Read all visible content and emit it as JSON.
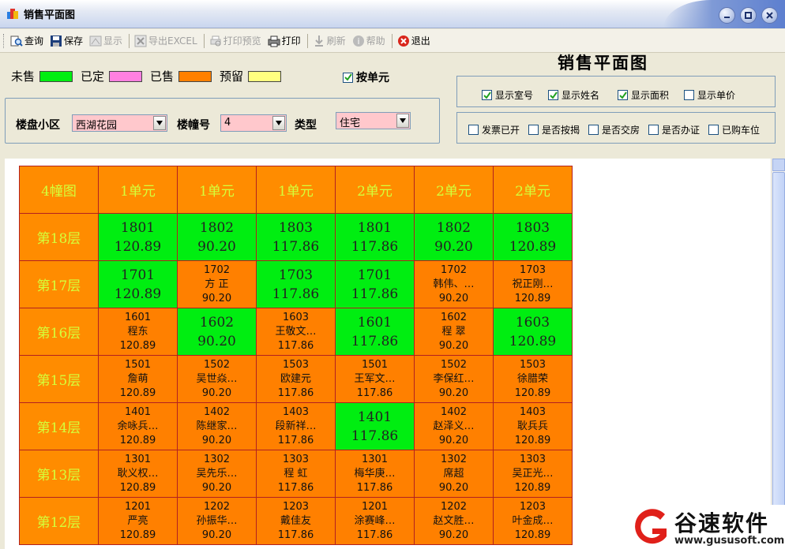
{
  "window": {
    "title": "销售平面图"
  },
  "toolbar": {
    "items": [
      {
        "label": "查询",
        "icon": "search-icon",
        "enabled": true
      },
      {
        "label": "保存",
        "icon": "save-icon",
        "enabled": true
      },
      {
        "label": "显示",
        "icon": "display-icon",
        "enabled": false
      },
      {
        "label": "导出EXCEL",
        "icon": "excel-icon",
        "enabled": false
      },
      {
        "label": "打印预览",
        "icon": "print-preview-icon",
        "enabled": false
      },
      {
        "label": "打印",
        "icon": "print-icon",
        "enabled": true
      },
      {
        "label": "刷新",
        "icon": "refresh-icon",
        "enabled": false
      },
      {
        "label": "帮助",
        "icon": "help-icon",
        "enabled": false
      },
      {
        "label": "退出",
        "icon": "exit-icon",
        "enabled": true
      }
    ]
  },
  "legend": {
    "items": [
      {
        "label": "未售",
        "color": "#00ee11"
      },
      {
        "label": "已定",
        "color": "#ff80e0"
      },
      {
        "label": "已售",
        "color": "#ff8000"
      },
      {
        "label": "预留",
        "color": "#ffff80"
      }
    ],
    "by_unit": {
      "label": "按单元",
      "checked": true
    }
  },
  "filter": {
    "estate_label": "楼盘小区",
    "estate_value": "西湖花园",
    "building_label": "楼幢号",
    "building_value": "4",
    "type_label": "类型",
    "type_value": "住宅"
  },
  "panel_title": "销售平面图",
  "display_options": [
    {
      "label": "显示室号",
      "checked": true
    },
    {
      "label": "显示姓名",
      "checked": true
    },
    {
      "label": "显示面积",
      "checked": true
    },
    {
      "label": "显示单价",
      "checked": false
    }
  ],
  "status_options": [
    {
      "label": "发票已开",
      "checked": false
    },
    {
      "label": "是否按揭",
      "checked": false
    },
    {
      "label": "是否交房",
      "checked": false
    },
    {
      "label": "是否办证",
      "checked": false
    },
    {
      "label": "已购车位",
      "checked": false
    }
  ],
  "grid": {
    "corner": "4幢图",
    "columns": [
      "1单元",
      "1单元",
      "1单元",
      "2单元",
      "2单元",
      "2单元"
    ],
    "rows": [
      {
        "floor": "第18层",
        "cells": [
          {
            "status": "unsold",
            "no": "1801",
            "area": "120.89"
          },
          {
            "status": "unsold",
            "no": "1802",
            "area": "90.20"
          },
          {
            "status": "unsold",
            "no": "1803",
            "area": "117.86"
          },
          {
            "status": "unsold",
            "no": "1801",
            "area": "117.86"
          },
          {
            "status": "unsold",
            "no": "1802",
            "area": "90.20"
          },
          {
            "status": "unsold",
            "no": "1803",
            "area": "120.89"
          }
        ]
      },
      {
        "floor": "第17层",
        "cells": [
          {
            "status": "unsold",
            "no": "1701",
            "area": "120.89"
          },
          {
            "status": "sold",
            "no": "1702",
            "name": "方 正",
            "area": "90.20"
          },
          {
            "status": "unsold",
            "no": "1703",
            "area": "117.86"
          },
          {
            "status": "unsold",
            "no": "1701",
            "area": "117.86"
          },
          {
            "status": "sold",
            "no": "1702",
            "name": "韩伟、…",
            "area": "90.20"
          },
          {
            "status": "sold",
            "no": "1703",
            "name": "祝正刚…",
            "area": "120.89"
          }
        ]
      },
      {
        "floor": "第16层",
        "cells": [
          {
            "status": "sold",
            "no": "1601",
            "name": "程东",
            "area": "120.89"
          },
          {
            "status": "unsold",
            "no": "1602",
            "area": "90.20"
          },
          {
            "status": "sold",
            "no": "1603",
            "name": "王敬文…",
            "area": "117.86"
          },
          {
            "status": "unsold",
            "no": "1601",
            "area": "117.86"
          },
          {
            "status": "sold",
            "no": "1602",
            "name": "程 翠",
            "area": "90.20"
          },
          {
            "status": "unsold",
            "no": "1603",
            "area": "120.89"
          }
        ]
      },
      {
        "floor": "第15层",
        "cells": [
          {
            "status": "sold",
            "no": "1501",
            "name": "詹萌",
            "area": "120.89"
          },
          {
            "status": "sold",
            "no": "1502",
            "name": "吴世焱…",
            "area": "90.20"
          },
          {
            "status": "sold",
            "no": "1503",
            "name": "欧建元",
            "area": "117.86"
          },
          {
            "status": "sold",
            "no": "1501",
            "name": "王军文…",
            "area": "117.86"
          },
          {
            "status": "sold",
            "no": "1502",
            "name": "李保红…",
            "area": "90.20"
          },
          {
            "status": "sold",
            "no": "1503",
            "name": "徐腊荣",
            "area": "120.89"
          }
        ]
      },
      {
        "floor": "第14层",
        "cells": [
          {
            "status": "sold",
            "no": "1401",
            "name": "余咏兵…",
            "area": "120.89"
          },
          {
            "status": "sold",
            "no": "1402",
            "name": "陈继家…",
            "area": "90.20"
          },
          {
            "status": "sold",
            "no": "1403",
            "name": "段新祥…",
            "area": "117.86"
          },
          {
            "status": "unsold",
            "no": "1401",
            "area": "117.86"
          },
          {
            "status": "sold",
            "no": "1402",
            "name": "赵泽义…",
            "area": "90.20"
          },
          {
            "status": "sold",
            "no": "1403",
            "name": "耿兵兵",
            "area": "120.89"
          }
        ]
      },
      {
        "floor": "第13层",
        "cells": [
          {
            "status": "sold",
            "no": "1301",
            "name": "耿义权…",
            "area": "120.89"
          },
          {
            "status": "sold",
            "no": "1302",
            "name": "吴先乐…",
            "area": "90.20"
          },
          {
            "status": "sold",
            "no": "1303",
            "name": "程 虹",
            "area": "117.86"
          },
          {
            "status": "sold",
            "no": "1301",
            "name": "梅华庚…",
            "area": "117.86"
          },
          {
            "status": "sold",
            "no": "1302",
            "name": "席超",
            "area": "90.20"
          },
          {
            "status": "sold",
            "no": "1303",
            "name": "吴正光…",
            "area": "120.89"
          }
        ]
      },
      {
        "floor": "第12层",
        "cells": [
          {
            "status": "sold",
            "no": "1201",
            "name": "严亮",
            "area": "120.89"
          },
          {
            "status": "sold",
            "no": "1202",
            "name": "孙振华…",
            "area": "90.20"
          },
          {
            "status": "sold",
            "no": "1203",
            "name": "戴佳友",
            "area": "117.86"
          },
          {
            "status": "sold",
            "no": "1201",
            "name": "涂赛峰…",
            "area": "117.86"
          },
          {
            "status": "sold",
            "no": "1202",
            "name": "赵文胜…",
            "area": "90.20"
          },
          {
            "status": "sold",
            "no": "1203",
            "name": "叶金成…",
            "area": "120.89"
          }
        ]
      }
    ]
  },
  "watermark": {
    "text": "谷速软件",
    "url": "www.gususoft.com"
  }
}
